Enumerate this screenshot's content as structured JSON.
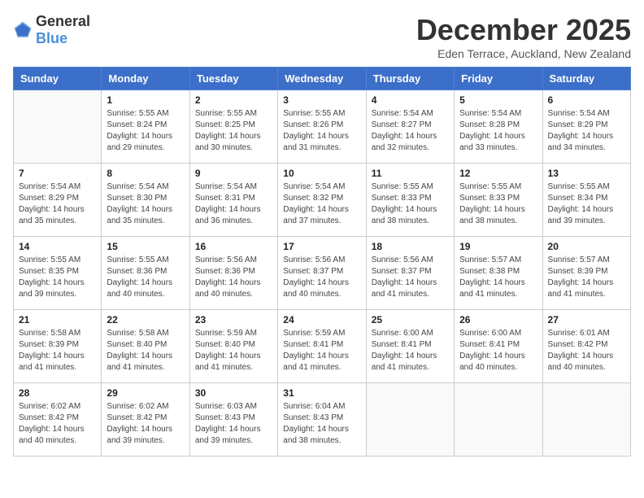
{
  "logo": {
    "text_general": "General",
    "text_blue": "Blue"
  },
  "title": "December 2025",
  "location": "Eden Terrace, Auckland, New Zealand",
  "weekdays": [
    "Sunday",
    "Monday",
    "Tuesday",
    "Wednesday",
    "Thursday",
    "Friday",
    "Saturday"
  ],
  "weeks": [
    [
      {
        "day": "",
        "sunrise": "",
        "sunset": "",
        "daylight": ""
      },
      {
        "day": "1",
        "sunrise": "Sunrise: 5:55 AM",
        "sunset": "Sunset: 8:24 PM",
        "daylight": "Daylight: 14 hours and 29 minutes."
      },
      {
        "day": "2",
        "sunrise": "Sunrise: 5:55 AM",
        "sunset": "Sunset: 8:25 PM",
        "daylight": "Daylight: 14 hours and 30 minutes."
      },
      {
        "day": "3",
        "sunrise": "Sunrise: 5:55 AM",
        "sunset": "Sunset: 8:26 PM",
        "daylight": "Daylight: 14 hours and 31 minutes."
      },
      {
        "day": "4",
        "sunrise": "Sunrise: 5:54 AM",
        "sunset": "Sunset: 8:27 PM",
        "daylight": "Daylight: 14 hours and 32 minutes."
      },
      {
        "day": "5",
        "sunrise": "Sunrise: 5:54 AM",
        "sunset": "Sunset: 8:28 PM",
        "daylight": "Daylight: 14 hours and 33 minutes."
      },
      {
        "day": "6",
        "sunrise": "Sunrise: 5:54 AM",
        "sunset": "Sunset: 8:29 PM",
        "daylight": "Daylight: 14 hours and 34 minutes."
      }
    ],
    [
      {
        "day": "7",
        "sunrise": "Sunrise: 5:54 AM",
        "sunset": "Sunset: 8:29 PM",
        "daylight": "Daylight: 14 hours and 35 minutes."
      },
      {
        "day": "8",
        "sunrise": "Sunrise: 5:54 AM",
        "sunset": "Sunset: 8:30 PM",
        "daylight": "Daylight: 14 hours and 35 minutes."
      },
      {
        "day": "9",
        "sunrise": "Sunrise: 5:54 AM",
        "sunset": "Sunset: 8:31 PM",
        "daylight": "Daylight: 14 hours and 36 minutes."
      },
      {
        "day": "10",
        "sunrise": "Sunrise: 5:54 AM",
        "sunset": "Sunset: 8:32 PM",
        "daylight": "Daylight: 14 hours and 37 minutes."
      },
      {
        "day": "11",
        "sunrise": "Sunrise: 5:55 AM",
        "sunset": "Sunset: 8:33 PM",
        "daylight": "Daylight: 14 hours and 38 minutes."
      },
      {
        "day": "12",
        "sunrise": "Sunrise: 5:55 AM",
        "sunset": "Sunset: 8:33 PM",
        "daylight": "Daylight: 14 hours and 38 minutes."
      },
      {
        "day": "13",
        "sunrise": "Sunrise: 5:55 AM",
        "sunset": "Sunset: 8:34 PM",
        "daylight": "Daylight: 14 hours and 39 minutes."
      }
    ],
    [
      {
        "day": "14",
        "sunrise": "Sunrise: 5:55 AM",
        "sunset": "Sunset: 8:35 PM",
        "daylight": "Daylight: 14 hours and 39 minutes."
      },
      {
        "day": "15",
        "sunrise": "Sunrise: 5:55 AM",
        "sunset": "Sunset: 8:36 PM",
        "daylight": "Daylight: 14 hours and 40 minutes."
      },
      {
        "day": "16",
        "sunrise": "Sunrise: 5:56 AM",
        "sunset": "Sunset: 8:36 PM",
        "daylight": "Daylight: 14 hours and 40 minutes."
      },
      {
        "day": "17",
        "sunrise": "Sunrise: 5:56 AM",
        "sunset": "Sunset: 8:37 PM",
        "daylight": "Daylight: 14 hours and 40 minutes."
      },
      {
        "day": "18",
        "sunrise": "Sunrise: 5:56 AM",
        "sunset": "Sunset: 8:37 PM",
        "daylight": "Daylight: 14 hours and 41 minutes."
      },
      {
        "day": "19",
        "sunrise": "Sunrise: 5:57 AM",
        "sunset": "Sunset: 8:38 PM",
        "daylight": "Daylight: 14 hours and 41 minutes."
      },
      {
        "day": "20",
        "sunrise": "Sunrise: 5:57 AM",
        "sunset": "Sunset: 8:39 PM",
        "daylight": "Daylight: 14 hours and 41 minutes."
      }
    ],
    [
      {
        "day": "21",
        "sunrise": "Sunrise: 5:58 AM",
        "sunset": "Sunset: 8:39 PM",
        "daylight": "Daylight: 14 hours and 41 minutes."
      },
      {
        "day": "22",
        "sunrise": "Sunrise: 5:58 AM",
        "sunset": "Sunset: 8:40 PM",
        "daylight": "Daylight: 14 hours and 41 minutes."
      },
      {
        "day": "23",
        "sunrise": "Sunrise: 5:59 AM",
        "sunset": "Sunset: 8:40 PM",
        "daylight": "Daylight: 14 hours and 41 minutes."
      },
      {
        "day": "24",
        "sunrise": "Sunrise: 5:59 AM",
        "sunset": "Sunset: 8:41 PM",
        "daylight": "Daylight: 14 hours and 41 minutes."
      },
      {
        "day": "25",
        "sunrise": "Sunrise: 6:00 AM",
        "sunset": "Sunset: 8:41 PM",
        "daylight": "Daylight: 14 hours and 41 minutes."
      },
      {
        "day": "26",
        "sunrise": "Sunrise: 6:00 AM",
        "sunset": "Sunset: 8:41 PM",
        "daylight": "Daylight: 14 hours and 40 minutes."
      },
      {
        "day": "27",
        "sunrise": "Sunrise: 6:01 AM",
        "sunset": "Sunset: 8:42 PM",
        "daylight": "Daylight: 14 hours and 40 minutes."
      }
    ],
    [
      {
        "day": "28",
        "sunrise": "Sunrise: 6:02 AM",
        "sunset": "Sunset: 8:42 PM",
        "daylight": "Daylight: 14 hours and 40 minutes."
      },
      {
        "day": "29",
        "sunrise": "Sunrise: 6:02 AM",
        "sunset": "Sunset: 8:42 PM",
        "daylight": "Daylight: 14 hours and 39 minutes."
      },
      {
        "day": "30",
        "sunrise": "Sunrise: 6:03 AM",
        "sunset": "Sunset: 8:43 PM",
        "daylight": "Daylight: 14 hours and 39 minutes."
      },
      {
        "day": "31",
        "sunrise": "Sunrise: 6:04 AM",
        "sunset": "Sunset: 8:43 PM",
        "daylight": "Daylight: 14 hours and 38 minutes."
      },
      {
        "day": "",
        "sunrise": "",
        "sunset": "",
        "daylight": ""
      },
      {
        "day": "",
        "sunrise": "",
        "sunset": "",
        "daylight": ""
      },
      {
        "day": "",
        "sunrise": "",
        "sunset": "",
        "daylight": ""
      }
    ]
  ]
}
